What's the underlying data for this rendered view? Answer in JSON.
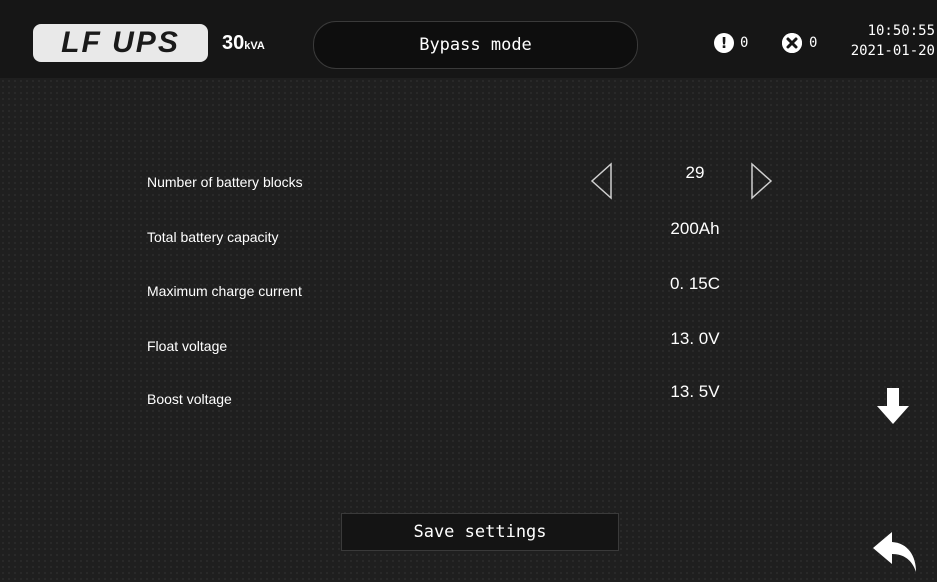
{
  "header": {
    "brand": "LF UPS",
    "power_value": "30",
    "power_unit": "kVA",
    "mode": "Bypass mode",
    "warning_count": "0",
    "fault_count": "0",
    "time": "10:50:55",
    "date": "2021-01-20"
  },
  "settings": [
    {
      "label": "Number of battery blocks",
      "value": "29"
    },
    {
      "label": "Total battery capacity",
      "value": "200Ah"
    },
    {
      "label": "Maximum  charge current",
      "value": "0. 15C"
    },
    {
      "label": "Float voltage",
      "value": "13. 0V"
    },
    {
      "label": "Boost voltage",
      "value": "13. 5V"
    }
  ],
  "actions": {
    "save_label": "Save settings"
  },
  "icons": {
    "decrement": "triangle-left-icon",
    "increment": "triangle-right-icon",
    "scroll_down": "arrow-down-icon",
    "back": "return-arrow-icon",
    "warning": "exclamation-circle-icon",
    "fault": "x-circle-icon"
  },
  "colors": {
    "background": "#1f1f1f",
    "header": "#161616",
    "logo_bg": "#e9e9e9",
    "text": "#ffffff"
  }
}
